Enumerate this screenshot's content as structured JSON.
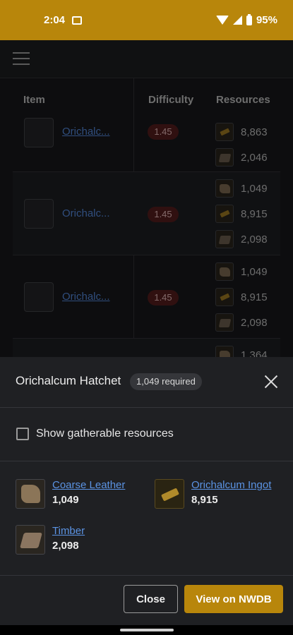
{
  "status": {
    "time": "2:04",
    "battery": "95%"
  },
  "table": {
    "headers": {
      "item": "Item",
      "difficulty": "Difficulty",
      "resources": "Resources"
    },
    "rows": [
      {
        "item": "Orichalc...",
        "difficulty": "1.45",
        "resources": [
          {
            "icon": "ingot-icon",
            "qty": "8,863"
          },
          {
            "icon": "timber-icon",
            "qty": "2,046"
          }
        ]
      },
      {
        "item": "Orichalc...",
        "difficulty": "1.45",
        "resources": [
          {
            "icon": "leather-icon",
            "qty": "1,049"
          },
          {
            "icon": "ingot-icon",
            "qty": "8,915"
          },
          {
            "icon": "timber-icon",
            "qty": "2,098"
          }
        ]
      },
      {
        "item": "Orichalc...",
        "difficulty": "1.45",
        "resources": [
          {
            "icon": "leather-icon",
            "qty": "1,049"
          },
          {
            "icon": "ingot-icon",
            "qty": "8,915"
          },
          {
            "icon": "timber-icon",
            "qty": "2,098"
          }
        ]
      },
      {
        "resources": [
          {
            "icon": "leather-icon",
            "qty": "1,364"
          }
        ]
      }
    ]
  },
  "sheet": {
    "title": "Orichalcum Hatchet",
    "required_badge": "1,049 required",
    "checkbox_label": "Show gatherable resources",
    "resources": [
      {
        "name": "Coarse Leather",
        "qty": "1,049",
        "icon": "coarse-leather-icon"
      },
      {
        "name": "Orichalcum Ingot",
        "qty": "8,915",
        "icon": "orichalcum-ingot-icon"
      },
      {
        "name": "Timber",
        "qty": "2,098",
        "icon": "timber-icon"
      }
    ],
    "close_label": "Close",
    "nwdb_label": "View on NWDB"
  },
  "colors": {
    "accent": "#b8860b",
    "link": "#5b93e3",
    "sheet_bg": "#1f2023"
  }
}
